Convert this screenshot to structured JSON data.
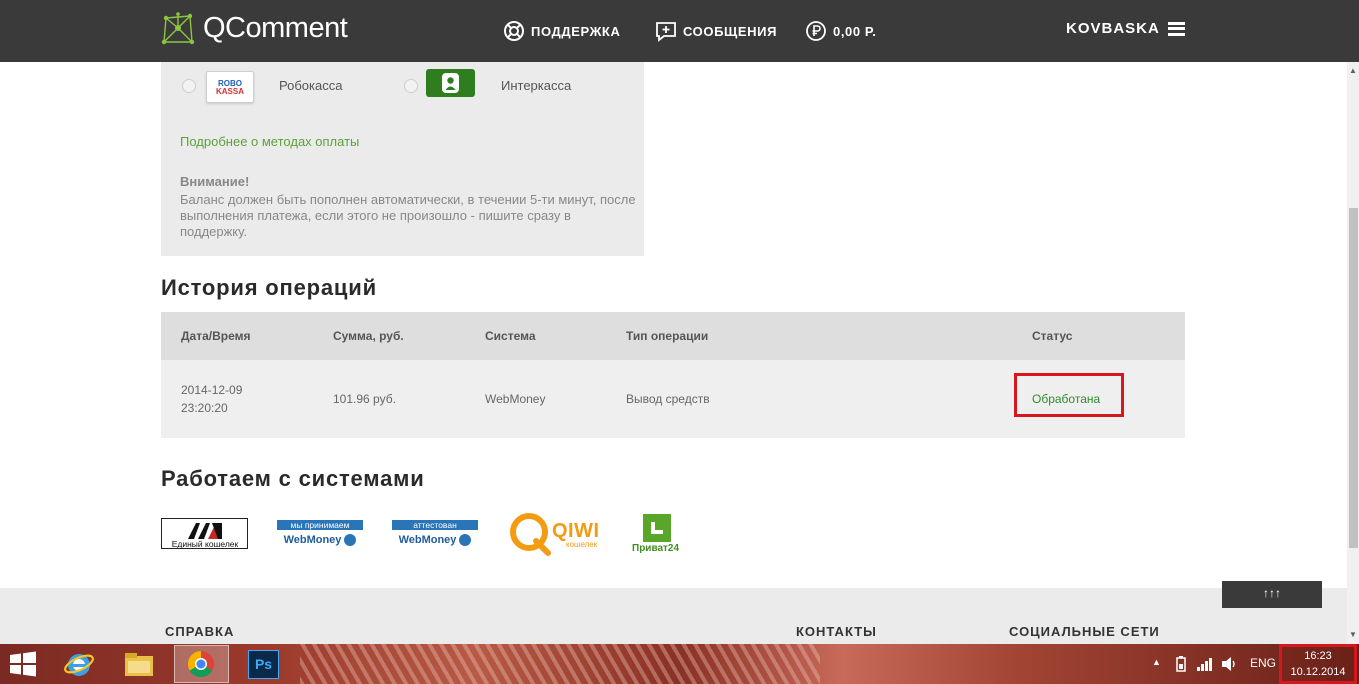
{
  "header": {
    "logo": "QComment",
    "nav": [
      {
        "label": "ПОДДЕРЖКА",
        "icon": "lifebuoy-icon"
      },
      {
        "label": "СООБЩЕНИЯ",
        "icon": "add-message-icon"
      },
      {
        "label": "0,00 Р.",
        "icon": "ruble-icon"
      }
    ],
    "user": "KOVBASKA"
  },
  "payment": {
    "methods": [
      {
        "name": "Робокасса",
        "logo_text_1": "ROBO",
        "logo_text_2": "KASSA"
      },
      {
        "name": "Интеркасса"
      }
    ],
    "more_link": "Подробнее о методах оплаты",
    "warning_title": "Внимание!",
    "warning_text": "Баланс должен быть пополнен автоматически, в течении 5-ти минут, после выполнения платежа, если этого не произошло - пишите сразу в поддержку."
  },
  "history": {
    "title": "История операций",
    "columns": [
      "Дата/Время",
      "Сумма, руб.",
      "Система",
      "Тип операции",
      "Статус"
    ],
    "rows": [
      {
        "date": "2014-12-09",
        "time": "23:20:20",
        "amount": "101.96 руб.",
        "system": "WebMoney",
        "type": "Вывод средств",
        "status": "Обработана"
      }
    ]
  },
  "partners": {
    "title": "Работаем с системами",
    "ew_text": "Единый кошелек",
    "wm1_top": "мы принимаем",
    "wm2_top": "аттестован",
    "wm_name": "WebMoney",
    "qiwi": "QIWI",
    "qiwi_sub": "кошелек",
    "privat": "Приват24"
  },
  "footer": {
    "columns": [
      "СПРАВКА",
      "КОНТАКТЫ",
      "СОЦИАЛЬНЫЕ СЕТИ"
    ],
    "up_button": "↑↑↑"
  },
  "taskbar": {
    "ps_label": "Ps",
    "lang": "ENG",
    "time": "16:23",
    "date": "10.12.2014"
  },
  "colors": {
    "header_bg": "#3a3a3a",
    "link_green": "#5ba23a",
    "status_green": "#2e8b2e",
    "highlight_red": "#d7161d"
  }
}
